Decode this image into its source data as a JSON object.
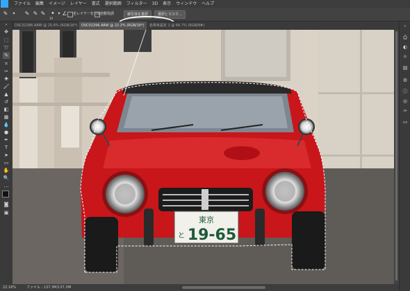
{
  "menubar": {
    "items": [
      "ファイル",
      "編集",
      "イメージ",
      "レイヤー",
      "書式",
      "選択範囲",
      "フィルター",
      "3D",
      "表示",
      "ウィンドウ",
      "ヘルプ"
    ]
  },
  "options": {
    "size_value": "34",
    "sample_all_layers": "全レイヤーを対象",
    "auto_enhance": "自動強調",
    "select_subject": "被写体を選択",
    "select_and_mask": "選択とマスク..."
  },
  "tabs": [
    {
      "label": "DSC02286.ARW @ 25.6% (RGB/16*)",
      "active": false
    },
    {
      "label": "DSC02296.ARW @ 22.2% (RGB/16*)",
      "active": true
    },
    {
      "label": "名称未設定 1 @ 66.7% (RGB/8#)",
      "active": false
    }
  ],
  "status": {
    "zoom": "22.18%",
    "file_info": "ファイル : 137.3M/137.3M"
  },
  "photo": {
    "plate_top": "東京",
    "plate_small": "と",
    "plate_number": "19-65",
    "car_color": "#c8161b",
    "wall_color": "#d9d1c4"
  },
  "tools_left": [
    "move-icon",
    "marquee-icon",
    "lasso-icon",
    "quick-select-icon",
    "crop-icon",
    "eyedropper-icon",
    "healing-icon",
    "brush-icon",
    "stamp-icon",
    "history-brush-icon",
    "eraser-icon",
    "gradient-icon",
    "blur-icon",
    "dodge-icon",
    "pen-icon",
    "type-icon",
    "path-select-icon",
    "shape-icon",
    "hand-icon",
    "zoom-icon",
    "more-icon",
    "color-swatch-icon",
    "quick-mask-icon",
    "screen-mode-icon"
  ],
  "tools_right": [
    "collapse-icon",
    "history-icon",
    "adjust-icon",
    "sun-icon",
    "layers-icon",
    "properties-icon",
    "info-icon",
    "channels-icon",
    "paths-icon",
    "libraries-icon"
  ]
}
